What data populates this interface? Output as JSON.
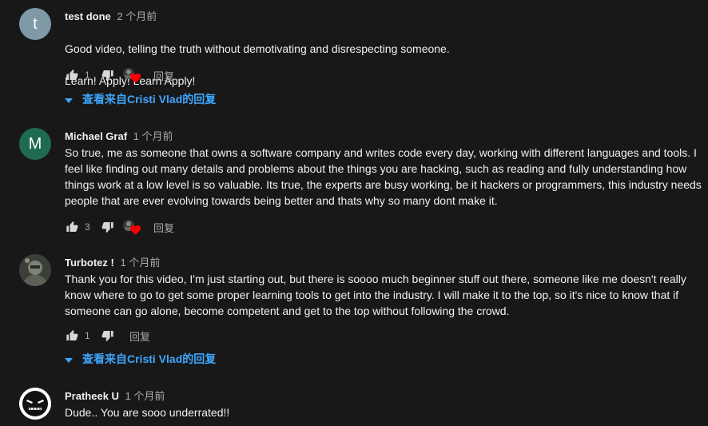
{
  "comments": [
    {
      "author": "test done",
      "time": "2 个月前",
      "avatar_letter": "t",
      "avatar_color": "#7f99a6",
      "lines": [
        "Good video, telling the truth without demotivating and disrespecting someone.",
        "Learn! Apply! Learn Apply!"
      ],
      "likes": "1",
      "reply_label": "回复",
      "view_replies": "查看来自Cristi Vlad的回复",
      "creator_heart": true
    },
    {
      "author": "Michael Graf",
      "time": "1 个月前",
      "avatar_letter": "M",
      "avatar_color": "#1f6b52",
      "lines": [
        "So true, me as someone that owns a software company and writes code every day, working with different languages and tools. I feel like finding out many details and problems about the things you are hacking, such as reading and fully understanding how things work at a low level is so valuable. Its true, the experts are busy working, be it hackers or programmers, this industry needs people that are ever evolving towards being better and thats why so many dont make it."
      ],
      "likes": "3",
      "reply_label": "回复",
      "creator_heart": true
    },
    {
      "author": "Turbotez !",
      "time": "1 个月前",
      "lines": [
        "Thank you for this video, I'm just starting out, but there is soooo much beginner stuff out there, someone like me doesn't really know where to go to get some proper learning tools to get into the industry. I will make it to the top, so it's nice to know that if someone can go alone, become competent and get to the top without following the crowd."
      ],
      "likes": "1",
      "reply_label": "回复",
      "view_replies": "查看来自Cristi Vlad的回复",
      "creator_heart": false
    },
    {
      "author": "Pratheek U",
      "time": "1 个月前",
      "lines": [
        "Dude.. You are sooo underrated!!"
      ]
    }
  ],
  "colors": {
    "background": "#181818",
    "text": "#f1f1f1",
    "secondary_text": "#aaaaaa",
    "link_blue": "#3ea6ff",
    "heart_red": "#ff0000"
  },
  "icons": {
    "like": "thumbs-up-icon",
    "dislike": "thumbs-down-icon",
    "heart": "heart-icon",
    "expand": "caret-down-icon"
  }
}
